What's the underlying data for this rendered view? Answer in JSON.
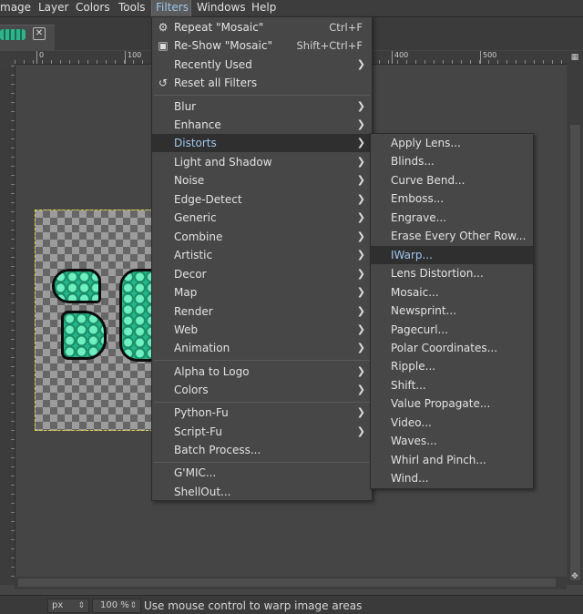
{
  "menubar": {
    "items": [
      {
        "label": "mage"
      },
      {
        "label": "Layer"
      },
      {
        "label": "Colors"
      },
      {
        "label": "Tools"
      },
      {
        "label": "Filters"
      },
      {
        "label": "Windows"
      },
      {
        "label": "Help"
      }
    ],
    "active": "Filters"
  },
  "ruler": {
    "ticks": [
      "0",
      "100",
      "400",
      "500"
    ]
  },
  "filters_menu": {
    "repeat": {
      "label": "Repeat \"Mosaic\"",
      "shortcut": "Ctrl+F",
      "icon": "repeat-filter-icon"
    },
    "reshow": {
      "label": "Re-Show \"Mosaic\"",
      "shortcut": "Shift+Ctrl+F",
      "icon": "reshow-filter-icon"
    },
    "recently_used": {
      "label": "Recently Used"
    },
    "reset": {
      "label": "Reset all Filters",
      "icon": "reset-icon"
    },
    "group1": [
      "Blur",
      "Enhance",
      "Distorts",
      "Light and Shadow",
      "Noise",
      "Edge-Detect",
      "Generic",
      "Combine",
      "Artistic",
      "Decor",
      "Map",
      "Render",
      "Web",
      "Animation"
    ],
    "group2": [
      "Alpha to Logo",
      "Colors"
    ],
    "group3": [
      "Python-Fu",
      "Script-Fu"
    ],
    "batch": "Batch Process...",
    "group4": [
      "G'MIC...",
      "ShellOut..."
    ],
    "highlighted": "Distorts"
  },
  "distorts_menu": {
    "items": [
      "Apply Lens...",
      "Blinds...",
      "Curve Bend...",
      "Emboss...",
      "Engrave...",
      "Erase Every Other Row...",
      "IWarp...",
      "Lens Distortion...",
      "Mosaic...",
      "Newsprint...",
      "Pagecurl...",
      "Polar Coordinates...",
      "Ripple...",
      "Shift...",
      "Value Propagate...",
      "Video...",
      "Waves...",
      "Whirl and Pinch...",
      "Wind..."
    ],
    "highlighted": "IWarp..."
  },
  "statusbar": {
    "unit": "px",
    "zoom": "100 %",
    "message": "Use mouse control to warp image areas"
  },
  "colors": {
    "highlight_text": "#9fc7ee",
    "menu_bg": "#474747",
    "canvas_bg": "#454545",
    "glyph_fill": "#23b88a"
  }
}
